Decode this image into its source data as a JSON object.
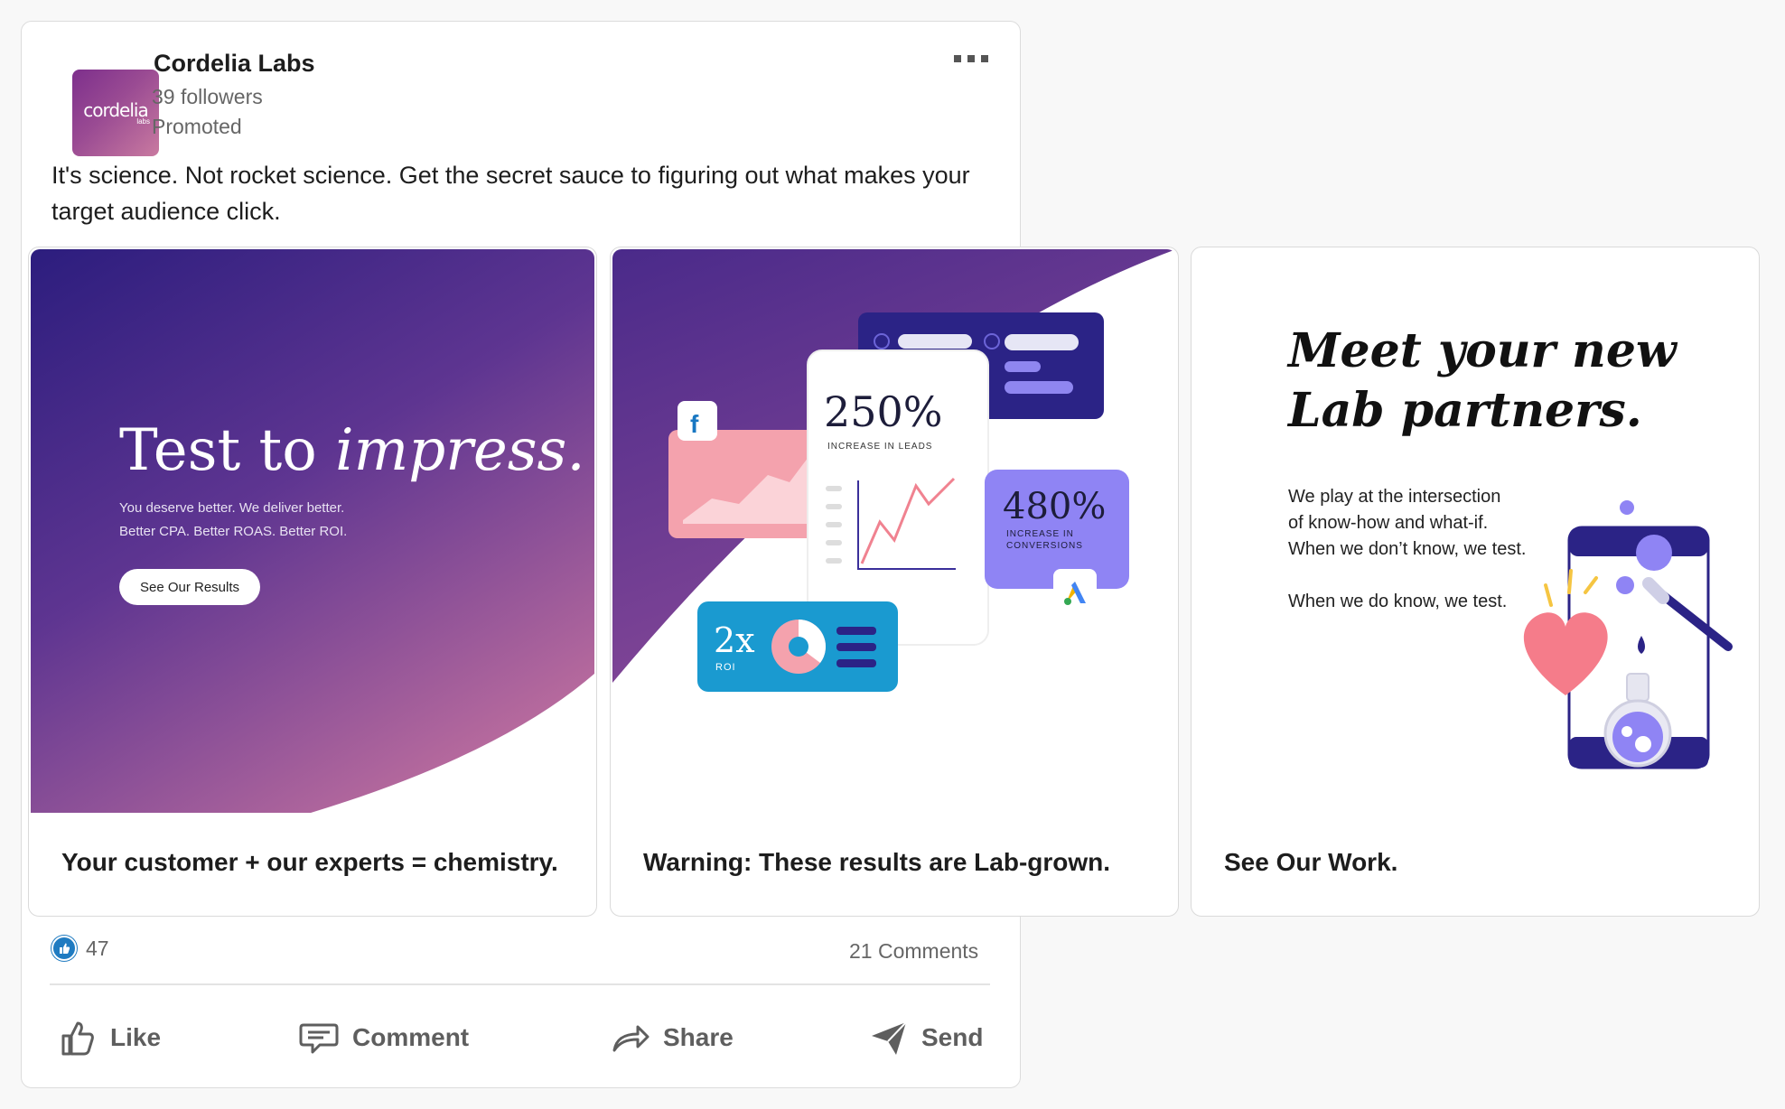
{
  "post": {
    "company_name": "Cordelia Labs",
    "logo_text": "cordelia",
    "logo_subtext": "labs",
    "followers": "39 followers",
    "promoted": "Promoted",
    "text": "It's science. Not rocket science. Get the secret sauce to figuring out what makes your target audience click."
  },
  "carousel": [
    {
      "headline_a": "Test to ",
      "headline_b": "impress.",
      "body_1": "You deserve better. We deliver better.",
      "body_2": "Better CPA. Better ROAS. Better ROI.",
      "button": "See Our Results",
      "caption": "Your customer + our experts = chemistry."
    },
    {
      "stat_main": "250%",
      "stat_main_label": "INCREASE IN LEADS",
      "stat_side": "480%",
      "stat_side_label_1": "INCREASE IN",
      "stat_side_label_2": "CONVERSIONS",
      "stat_roi": "2x",
      "stat_roi_label": "ROI",
      "caption": "Warning: These results are Lab-grown."
    },
    {
      "headline_1": "Meet your new",
      "headline_2": "Lab partners.",
      "body_1": "We play at the intersection",
      "body_2": "of know-how and what-if.",
      "body_3": "When we don’t know, we test.",
      "body_4": "When we do know, we test.",
      "caption": "See Our Work."
    }
  ],
  "social": {
    "reaction_count": "47",
    "comments": "21 Comments"
  },
  "actions": {
    "like": "Like",
    "comment": "Comment",
    "share": "Share",
    "send": "Send"
  },
  "colors": {
    "purple_dark": "#2c1a7a",
    "purple_mid": "#6b3a8f",
    "pink": "#c4769e",
    "like_blue": "#1f7bc1"
  }
}
